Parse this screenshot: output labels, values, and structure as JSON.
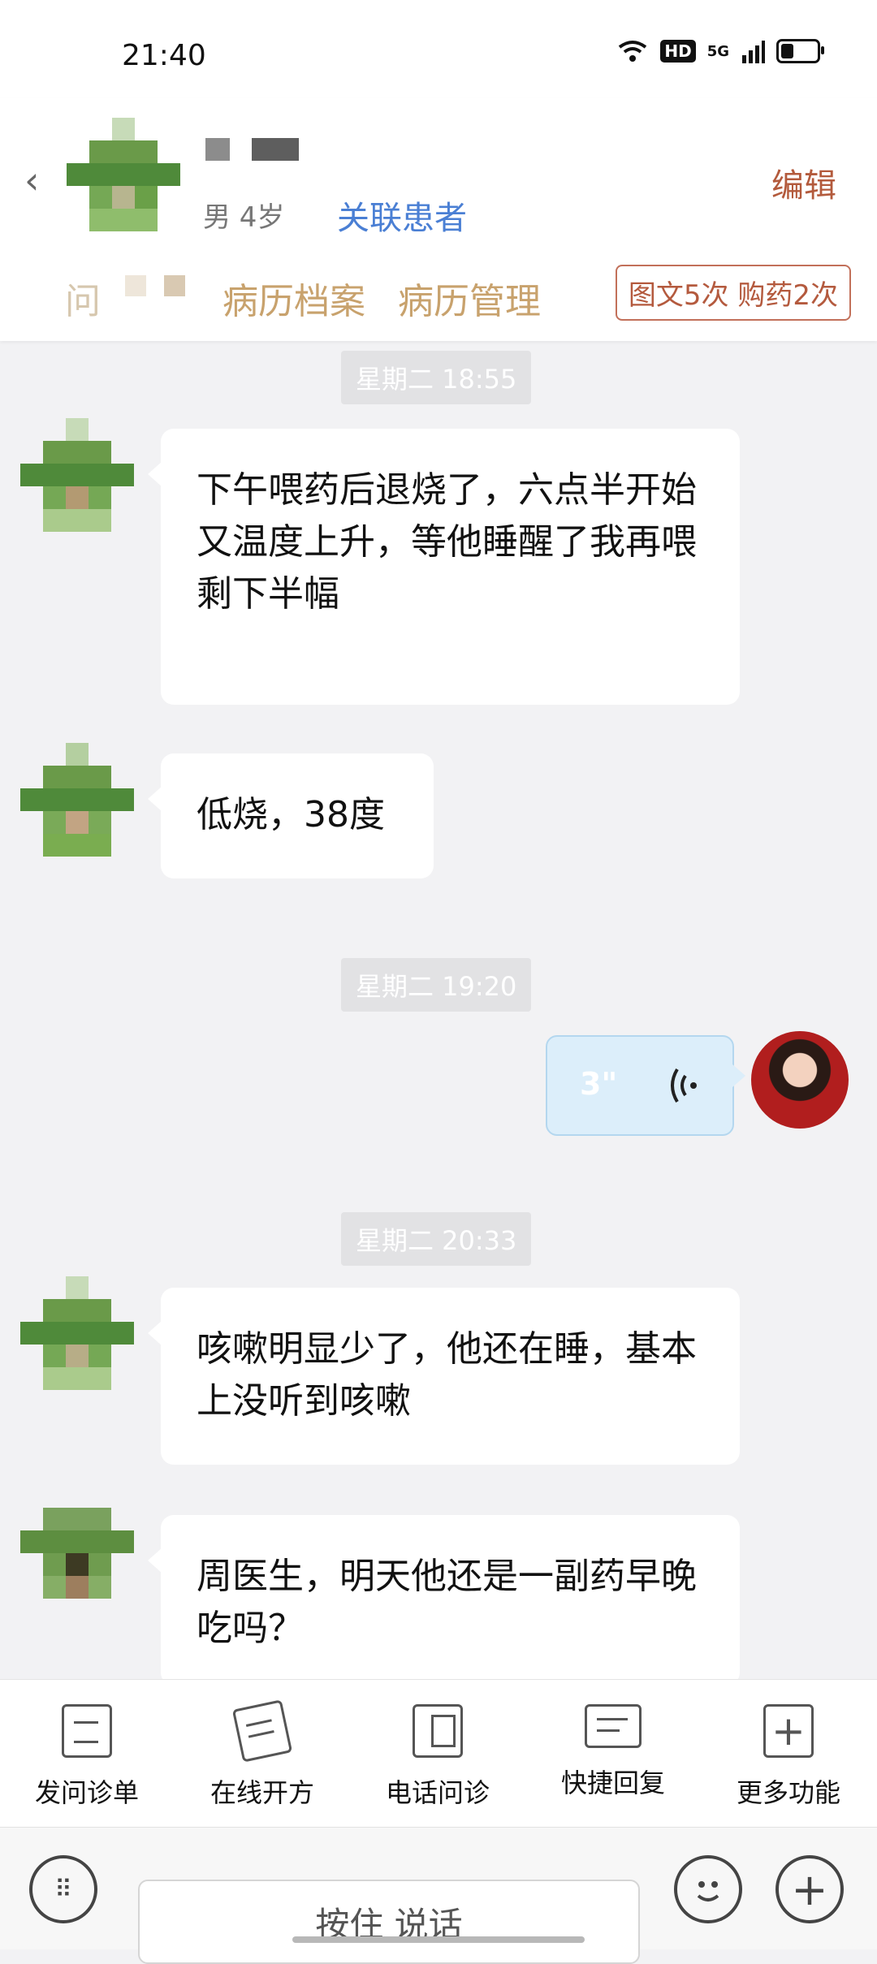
{
  "status": {
    "time": "21:40",
    "network": "5G",
    "hd": "HD"
  },
  "header": {
    "gender_age": "男 4岁",
    "link_label": "关联患者",
    "edit_label": "编辑",
    "tabs": [
      "问",
      "病历档案",
      "病历管理"
    ],
    "badge": "图文5次 购药2次"
  },
  "chat": {
    "timestamps": [
      "星期二 18:55",
      "星期二 19:20",
      "星期二 20:33"
    ],
    "messages": [
      {
        "from": "patient",
        "text": "下午喂药后退烧了，六点半开始又温度上升，等他睡醒了我再喂剩下半幅"
      },
      {
        "from": "patient",
        "text": "低烧，38度"
      },
      {
        "from": "doctor",
        "type": "voice",
        "duration": "3\""
      },
      {
        "from": "patient",
        "text": "咳嗽明显少了，他还在睡，基本上没听到咳嗽"
      },
      {
        "from": "patient",
        "text": "周医生，明天他还是一副药早晚吃吗？"
      }
    ]
  },
  "toolbar": {
    "items": [
      "发问诊单",
      "在线开方",
      "电话问诊",
      "快捷回复",
      "更多功能"
    ]
  },
  "input": {
    "hold_label": "按住 说话"
  },
  "colors": {
    "accent": "#b35a3c",
    "link": "#4a7fd4",
    "tab": "#c8a26d",
    "voice_bg": "#dceefa"
  }
}
